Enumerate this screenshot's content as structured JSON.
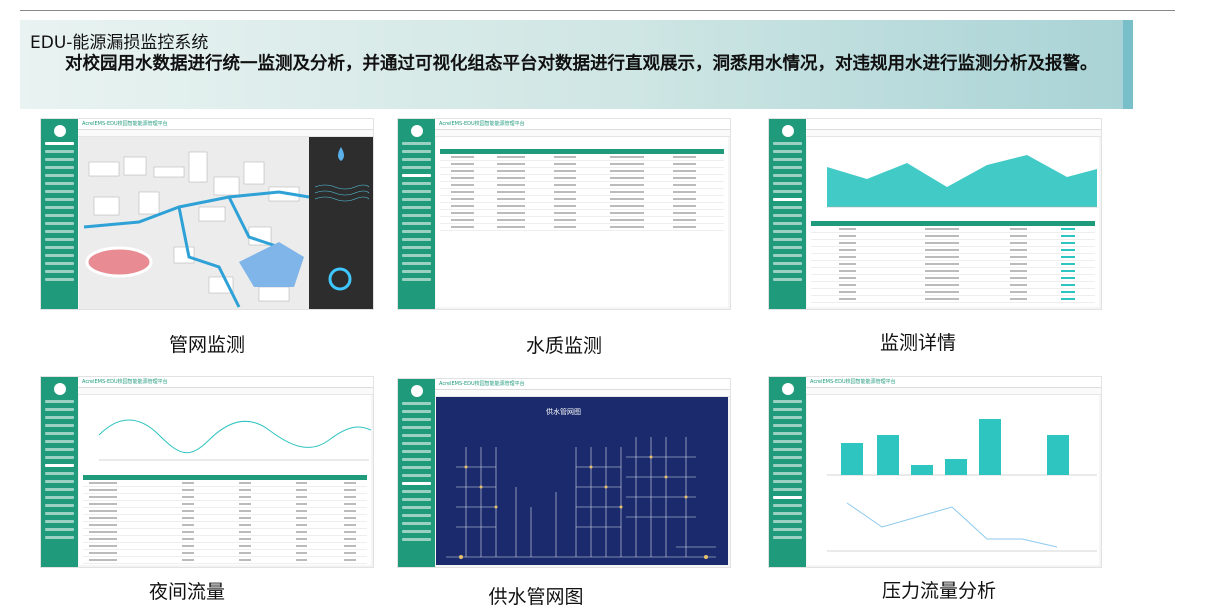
{
  "banner": {
    "title": "EDU-能源漏损监控系统",
    "description": "对校园用水数据进行统一监测及分析，并通过可视化组态平台对数据进行直观展示，洞悉用水情况，对违规用水进行监测分析及报警。"
  },
  "app": {
    "title": "AcrelEMS-EDU校园智能能源管理平台"
  },
  "panels": [
    {
      "caption": "管网监测"
    },
    {
      "caption": "水质监测"
    },
    {
      "caption": "监测详情"
    },
    {
      "caption": "夜间流量"
    },
    {
      "caption": "供水管网图",
      "diagram_title": "供水管网图"
    },
    {
      "caption": "压力流量分析"
    }
  ],
  "colors": {
    "sidebar": "#1f9a7b",
    "accent": "#2ec4c0",
    "diagram_bg": "#1a2a6c",
    "banner_edge": "#79bfc9"
  }
}
